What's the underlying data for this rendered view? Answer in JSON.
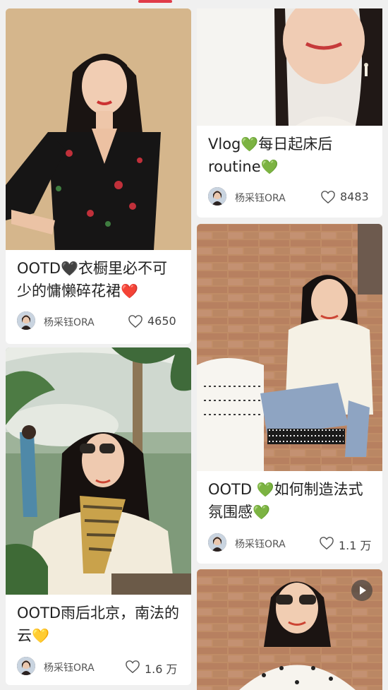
{
  "posts": [
    {
      "title_a": "OOTD",
      "emoji_a": "🖤",
      "title_b": "衣橱里必不可少的慵懒碎花裙",
      "emoji_b": "❤️",
      "author": "杨采钰ORA",
      "likes": "4650"
    },
    {
      "title_a": "Vlog",
      "emoji_a": "💚",
      "title_b": "每日起床后routine",
      "emoji_b": "💚",
      "author": "杨采钰ORA",
      "likes": "8483"
    },
    {
      "title_a": "OOTD雨后北京，南法的云",
      "emoji_a": "💛",
      "title_b": "",
      "emoji_b": "",
      "author": "杨采钰ORA",
      "likes": "1.6 万"
    },
    {
      "title_a": "OOTD ",
      "emoji_a": "💚",
      "title_b": "如何制造法式氛围感",
      "emoji_b": "💚",
      "author": "杨采钰ORA",
      "likes": "1.1 万"
    }
  ],
  "colors": {
    "accent": "#e03b48",
    "card": "#ffffff",
    "background": "#f0f0f0"
  },
  "icons": {
    "like": "heart-outline-icon",
    "video": "play-icon"
  }
}
